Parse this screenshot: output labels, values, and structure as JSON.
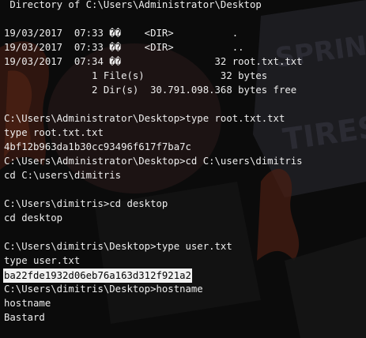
{
  "terminal": {
    "theme": {
      "background": "#0a0a0a",
      "text": "#ededed",
      "selection_background": "#f2f2f2",
      "selection_text": "#000000"
    },
    "lines": [
      {
        "text": " Directory of C:\\Users\\Administrator\\Desktop",
        "highlight": false
      },
      {
        "text": "19/03/2017  07:33 ��    <DIR>          .",
        "highlight": false
      },
      {
        "text": "19/03/2017  07:33 ��    <DIR>          ..",
        "highlight": false
      },
      {
        "text": "19/03/2017  07:34 ��                32 root.txt.txt",
        "highlight": false
      },
      {
        "text": "               1 File(s)             32 bytes",
        "highlight": false
      },
      {
        "text": "               2 Dir(s)  30.791.098.368 bytes free",
        "highlight": false
      },
      {
        "text": "C:\\Users\\Administrator\\Desktop>type root.txt.txt",
        "highlight": false
      },
      {
        "text": "type root.txt.txt",
        "highlight": false
      },
      {
        "text": "4bf12b963da1b30cc93496f617f7ba7c",
        "highlight": false
      },
      {
        "text": "C:\\Users\\Administrator\\Desktop>cd C:\\users\\dimitris",
        "highlight": false
      },
      {
        "text": "cd C:\\users\\dimitris",
        "highlight": false
      },
      {
        "text": "C:\\Users\\dimitris>cd desktop",
        "highlight": false
      },
      {
        "text": "cd desktop",
        "highlight": false
      },
      {
        "text": "C:\\Users\\dimitris\\Desktop>type user.txt",
        "highlight": false
      },
      {
        "text": "type user.txt",
        "highlight": false
      },
      {
        "text": "ba22fde1932d06eb76a163d312f921a2",
        "highlight": true
      },
      {
        "text": "C:\\Users\\dimitris\\Desktop>hostname",
        "highlight": false
      },
      {
        "text": "hostname",
        "highlight": false
      },
      {
        "text": "Bastard",
        "highlight": false
      }
    ]
  },
  "wallpaper": {
    "sign_text": "SPRING TIRES",
    "colors": {
      "blob": "#3a1f1f",
      "flame_outer": "#5a2b16",
      "flame_inner": "#7a4a1a",
      "sign": "#24242a"
    }
  }
}
